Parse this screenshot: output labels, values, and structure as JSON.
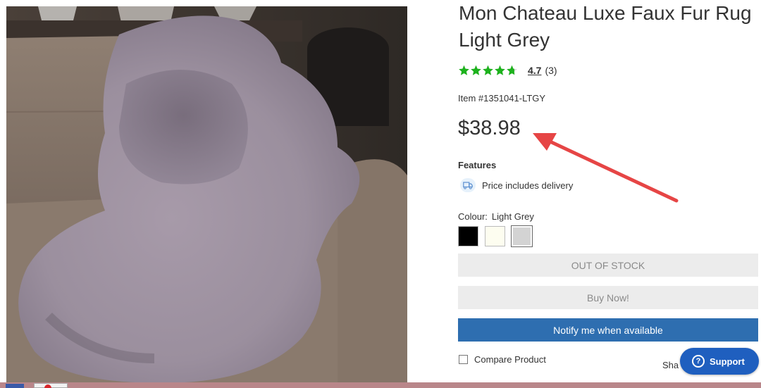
{
  "product": {
    "title": "Mon Chateau Luxe Faux Fur Rug Light Grey",
    "rating_value": "4.7",
    "rating_count": "(3)",
    "rating_stars": 4.7,
    "item_number": "Item #1351041-LTGY",
    "price": "$38.98"
  },
  "features": {
    "heading": "Features",
    "items": [
      {
        "icon": "truck-icon",
        "text": "Price includes delivery"
      }
    ]
  },
  "colour": {
    "label": "Colour:",
    "selected": "Light Grey",
    "swatches": [
      {
        "name": "Black",
        "color": "#000000"
      },
      {
        "name": "Cream",
        "color": "#fdfdf0"
      },
      {
        "name": "Light Grey",
        "color": "#d3d3d3"
      }
    ]
  },
  "actions": {
    "out_of_stock": "OUT OF STOCK",
    "buy_now": "Buy Now!",
    "notify": "Notify me when available",
    "compare": "Compare Product",
    "share": "Sha"
  },
  "support": {
    "label": "Support",
    "icon": "help-circle-icon"
  },
  "colors": {
    "primary_button": "#2e6eb0",
    "star_green": "#1db21d",
    "annotation_arrow": "#e64545",
    "support_bubble": "#1f5fbf"
  }
}
